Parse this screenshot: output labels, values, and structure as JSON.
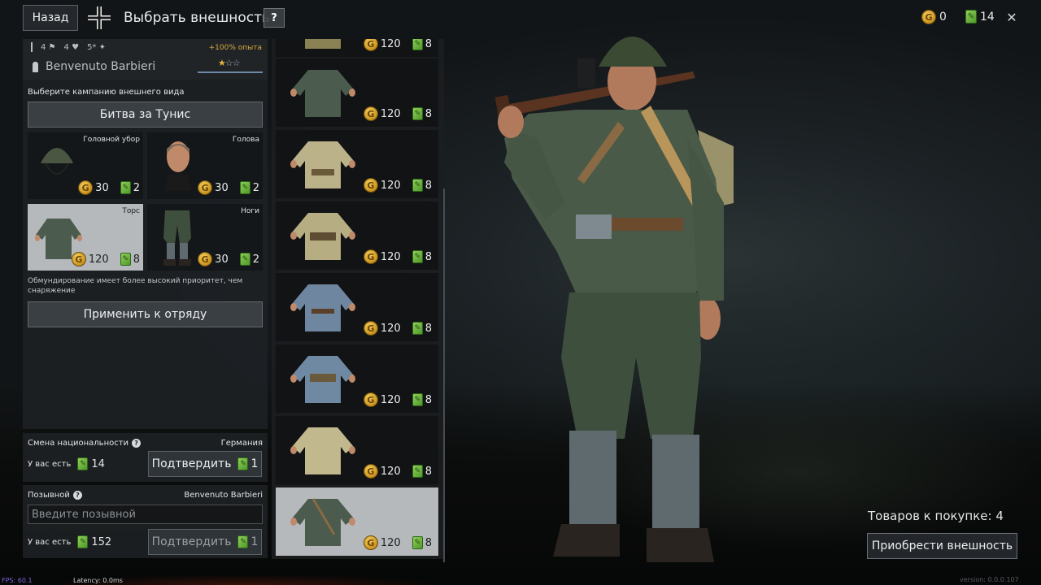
{
  "header": {
    "back_label": "Назад",
    "title": "Выбрать внешность",
    "help_label": "?",
    "gold": "0",
    "tickets": "14",
    "close_label": "✕"
  },
  "soldier": {
    "stats": [
      "4",
      "4",
      "5*"
    ],
    "bonus": "+100% опыта",
    "name": "Benvenuto Barbieri",
    "stars_filled": "★",
    "stars_empty": "☆☆"
  },
  "appearance": {
    "campaign_label": "Выберите кампанию внешнего вида",
    "campaign_value": "Битва за Тунис",
    "slots": [
      {
        "label": "Головной убор",
        "gold": "30",
        "tickets": "2"
      },
      {
        "label": "Голова",
        "gold": "30",
        "tickets": "2"
      },
      {
        "label": "Торс",
        "gold": "120",
        "tickets": "8"
      },
      {
        "label": "Ноги",
        "gold": "30",
        "tickets": "2"
      }
    ],
    "note": "Обмундирование имеет более высокий приоритет, чем снаряжение",
    "apply_label": "Применить к отряду"
  },
  "nationality": {
    "title": "Смена национальности",
    "value": "Германия",
    "have_label": "У вас есть",
    "have_value": "14",
    "confirm_label": "Подтвердить",
    "confirm_cost": "1"
  },
  "callsign": {
    "title": "Позывной",
    "value": "Benvenuto Barbieri",
    "placeholder": "Введите позывной",
    "have_label": "У вас есть",
    "have_value": "152",
    "confirm_label": "Подтвердить",
    "confirm_cost": "1"
  },
  "items": [
    {
      "gold": "120",
      "tickets": "8"
    },
    {
      "gold": "120",
      "tickets": "8"
    },
    {
      "gold": "120",
      "tickets": "8"
    },
    {
      "gold": "120",
      "tickets": "8"
    },
    {
      "gold": "120",
      "tickets": "8"
    },
    {
      "gold": "120",
      "tickets": "8"
    },
    {
      "gold": "120",
      "tickets": "8"
    },
    {
      "gold": "120",
      "tickets": "8"
    }
  ],
  "cart": {
    "to_buy": "Товаров к покупке: 4",
    "purchase_label": "Приобрести внешность"
  },
  "debug": {
    "fps": "FPS: 60.1",
    "latency": "Latency: 0.0ms",
    "version": "version: 0.0.0.107"
  },
  "colors": {
    "gold": "#e0a52a",
    "ticket": "#6ab43c",
    "panel": "#1e2124",
    "selected": "#b5b9bb"
  }
}
